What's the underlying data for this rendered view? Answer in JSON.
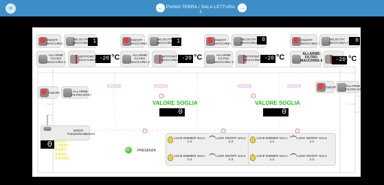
{
  "header": {
    "title": "PIANO TERRA / SALA LETTURA 1",
    "menu_icon": "hamburger-icon",
    "prev_icon": "arrow-left-icon",
    "next_icon": "arrow-right-icon",
    "bar_color": "#3d8fc8"
  },
  "machines": [
    {
      "onoff": "ON/OFF\nMACCHINA 1",
      "velocita": "VELOCITA'\nMACCHINA 1",
      "speed": "1",
      "allarme": "ALLARME\nFILTRO\nMACCHINA 1",
      "setpoint": "SETPOINT\nMACCHINA 1",
      "temp": "-20"
    },
    {
      "onoff": "ON/OFF\nMACCHINA 2",
      "velocita": "VELOCITA'\nMACCHINA 2",
      "speed": "1",
      "allarme": "ALLARME\nFILTRO\nMACCHINA 2",
      "setpoint": "SETPOINT\nMACCHINA 2",
      "temp": "-20"
    },
    {
      "onoff": "ON/OFF\nMACCHINA 3",
      "velocita": "VELOCITA'\nMACCHINA 3",
      "speed": "0",
      "allarme": "ALLARME\nFILTRO\nMACCHINA 3",
      "setpoint": "SETPOINT\nMACCHINA 3",
      "temp": "-20"
    },
    {
      "onoff": "ON/OFF\nMACCHINA 4",
      "velocita": "VELOCITA'\nMACCHINA 4",
      "speed": "0",
      "allarme": "ALLARME\nFILTRO\nMACCHINA 4",
      "setpoint": "SETPOINT\nMACCHINA 4",
      "temp": "-20"
    }
  ],
  "degree_unit": "°C",
  "erv_left": {
    "onoff": "ON/OFF ERV+",
    "allarme": "ALLARME\nFILTRO ERV+"
  },
  "erv_right": {
    "onoff": "ON/OFF ERV+",
    "allarme": "ALLARME\nFILTRO ERV+"
  },
  "soglia": [
    {
      "label": "VALORE SOGLIA",
      "value": "0"
    },
    {
      "label": "VALORE SOGLIA",
      "value": "0"
    }
  ],
  "modo": {
    "label": "MODO\nFUNZIONAMENTO",
    "value": "0"
  },
  "modes": [
    "0 OFF",
    "1 TEST",
    "2 ERV",
    "3 FAN",
    "4 AUTO"
  ],
  "presenza": "PRESENZA",
  "lights_left": [
    {
      "dimmer": "LUCE DIMMER SALA\n1-2",
      "onoff": "LUCE ON/OFF SALA\n1-2"
    },
    {
      "dimmer": "LUCE DIMMER SALA\n1-4",
      "onoff": "LUCE ON/OFF SALA\n1-4"
    }
  ],
  "lights_right": [
    {
      "dimmer": "LUCE DIMMER SALA\n1-1",
      "onoff": "LUCE ON/OFF SALA\n1-1"
    },
    {
      "dimmer": "LUCE DIMMER SALA\n1-2",
      "onoff": "LUCE ON/OFF SALA\n1-2"
    }
  ],
  "colors": {
    "soglia_text": "#22c21e",
    "modes_text": "#f2e021",
    "background": "#000000"
  }
}
